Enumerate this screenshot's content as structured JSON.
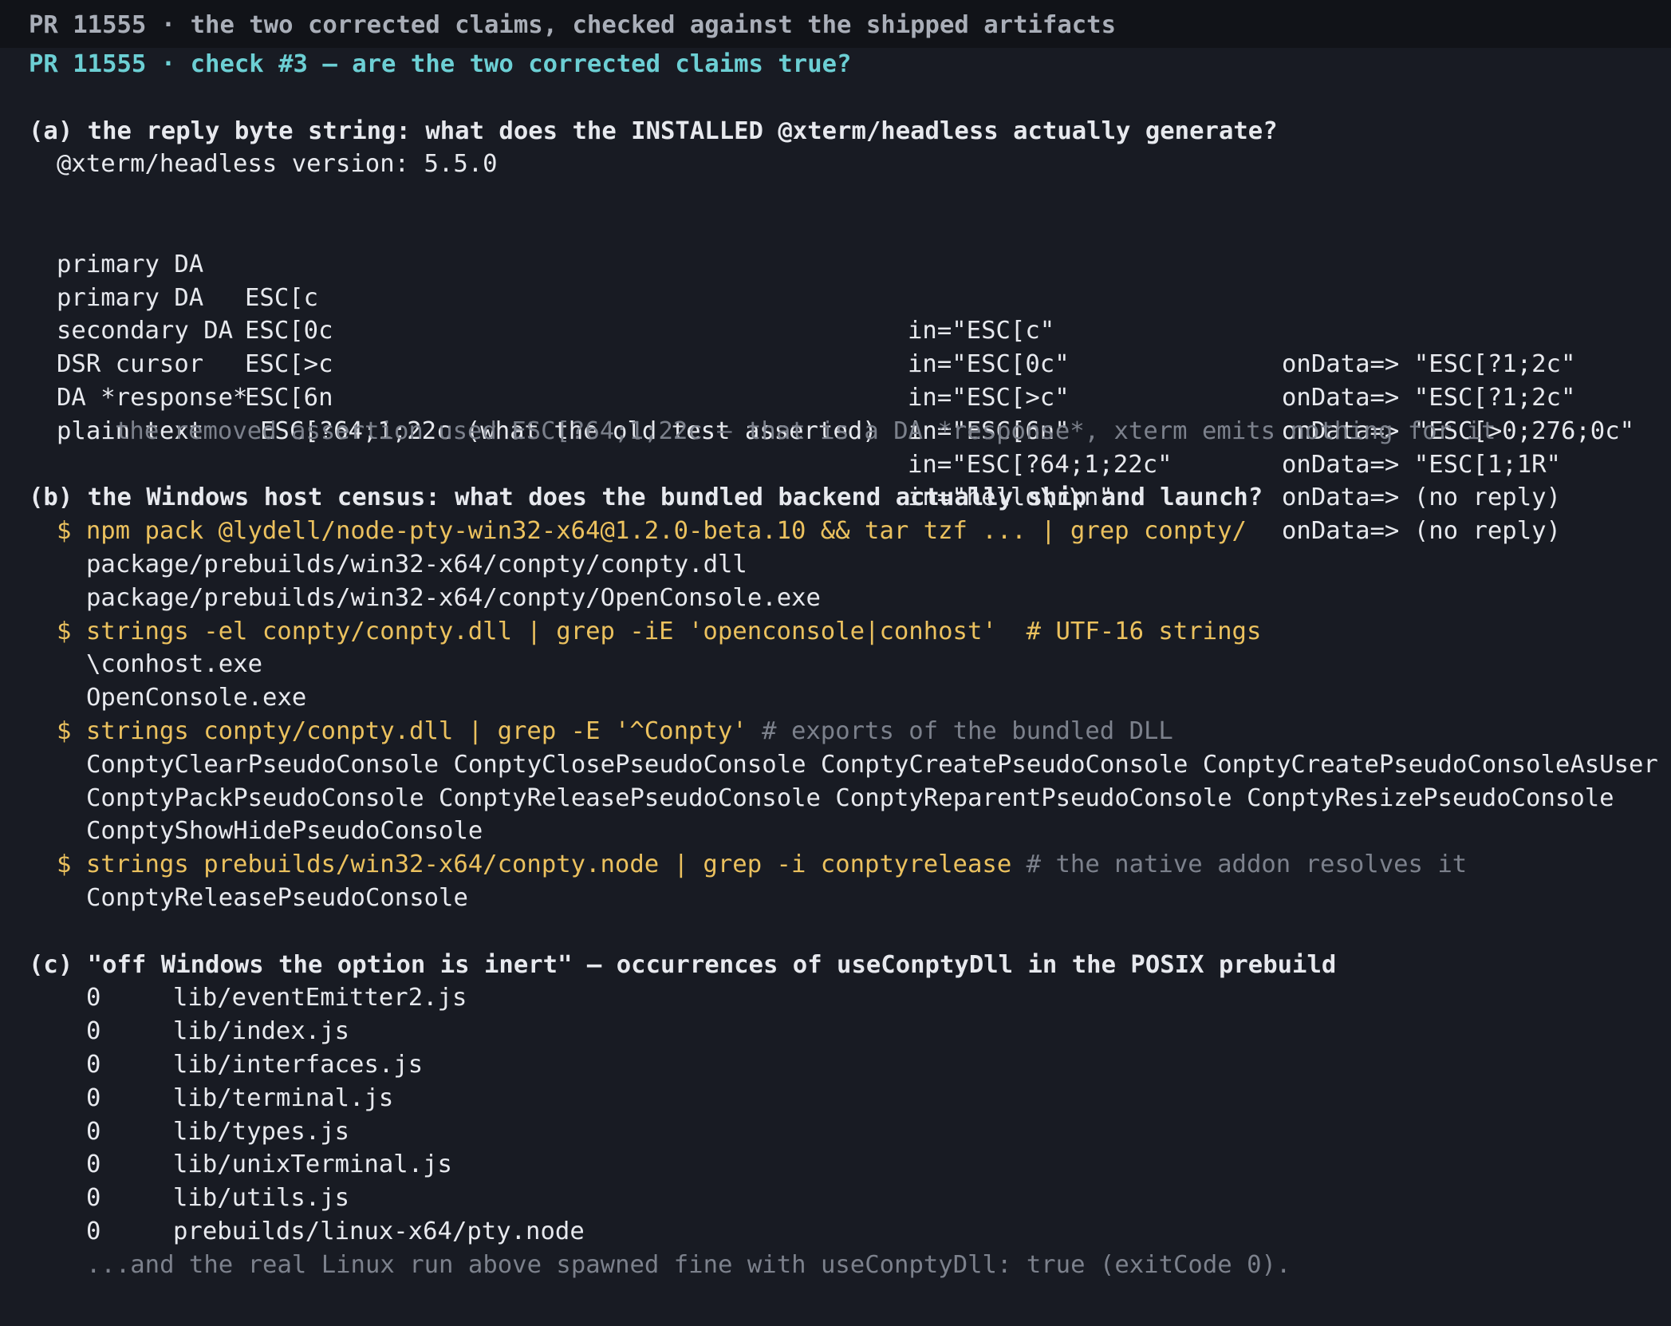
{
  "window": {
    "title": "PR 11555 · the two corrected claims, checked against the shipped artifacts"
  },
  "header": {
    "line": "PR 11555 · check #3 — are the two corrected claims true?"
  },
  "section_a": {
    "heading": "(a) the reply byte string: what does the INSTALLED @xterm/headless actually generate?",
    "version_line": "@xterm/headless version: 5.5.0",
    "rows": [
      {
        "label": "primary DA",
        "seq": "ESC[c",
        "input": "in=\"ESC[c\"",
        "output": "onData=> \"ESC[?1;2c\""
      },
      {
        "label": "primary DA",
        "seq": "ESC[0c",
        "input": "in=\"ESC[0c\"",
        "output": "onData=> \"ESC[?1;2c\""
      },
      {
        "label": "secondary DA",
        "seq": "ESC[>c",
        "input": "in=\"ESC[>c\"",
        "output": "onData=> \"ESC[>0;276;0c\""
      },
      {
        "label": "DSR cursor",
        "seq": "ESC[6n",
        "input": "in=\"ESC[6n\"",
        "output": "onData=> \"ESC[1;1R\""
      },
      {
        "label": "DA *response*",
        "seq": "ESC[?64;1;22c (what the old test asserted)",
        "input": "in=\"ESC[?64;1;22c\"",
        "output": "onData=> (no reply)"
      },
      {
        "label": "plain text",
        "seq": "",
        "input": "in=\"hello\\r\\n\"",
        "output": "onData=> (no reply)"
      }
    ],
    "note": "the removed assertion used ESC[?64;1;22c — that is a DA *response*, xterm emits nothing for it"
  },
  "section_b": {
    "heading": "(b) the Windows host census: what does the bundled backend actually ship and launch?",
    "blocks": [
      {
        "cmd": "$ npm pack @lydell/node-pty-win32-x64@1.2.0-beta.10 && tar tzf ... | grep conpty/",
        "comment": "",
        "output": [
          "package/prebuilds/win32-x64/conpty/conpty.dll",
          "package/prebuilds/win32-x64/conpty/OpenConsole.exe"
        ]
      },
      {
        "cmd": "$ strings -el conpty/conpty.dll | grep -iE 'openconsole|conhost'  # UTF-16 strings",
        "comment": "",
        "output": [
          "\\conhost.exe",
          "OpenConsole.exe"
        ]
      },
      {
        "cmd": "$ strings conpty/conpty.dll | grep -E '^Conpty'",
        "comment": " # exports of the bundled DLL",
        "output": [
          "ConptyClearPseudoConsole ConptyClosePseudoConsole ConptyCreatePseudoConsole ConptyCreatePseudoConsoleAsUser",
          "ConptyPackPseudoConsole ConptyReleasePseudoConsole ConptyReparentPseudoConsole ConptyResizePseudoConsole",
          "ConptyShowHidePseudoConsole"
        ]
      },
      {
        "cmd": "$ strings prebuilds/win32-x64/conpty.node | grep -i conptyrelease",
        "comment": " # the native addon resolves it",
        "output": [
          "ConptyReleasePseudoConsole"
        ]
      }
    ]
  },
  "section_c": {
    "heading": "(c) \"off Windows the option is inert\" — occurrences of useConptyDll in the POSIX prebuild",
    "rows": [
      {
        "count": "0",
        "path": "lib/eventEmitter2.js"
      },
      {
        "count": "0",
        "path": "lib/index.js"
      },
      {
        "count": "0",
        "path": "lib/interfaces.js"
      },
      {
        "count": "0",
        "path": "lib/terminal.js"
      },
      {
        "count": "0",
        "path": "lib/types.js"
      },
      {
        "count": "0",
        "path": "lib/unixTerminal.js"
      },
      {
        "count": "0",
        "path": "lib/utils.js"
      },
      {
        "count": "0",
        "path": "prebuilds/linux-x64/pty.node"
      }
    ],
    "footer": "...and the real Linux run above spawned fine with useConptyDll: true (exitCode 0)."
  },
  "colors": {
    "background": "#181b23",
    "titlebar": "#111318",
    "cyan": "#6ccfd4",
    "yellow": "#ebc15e",
    "grey": "#7c818c",
    "text": "#e7e9ee"
  }
}
